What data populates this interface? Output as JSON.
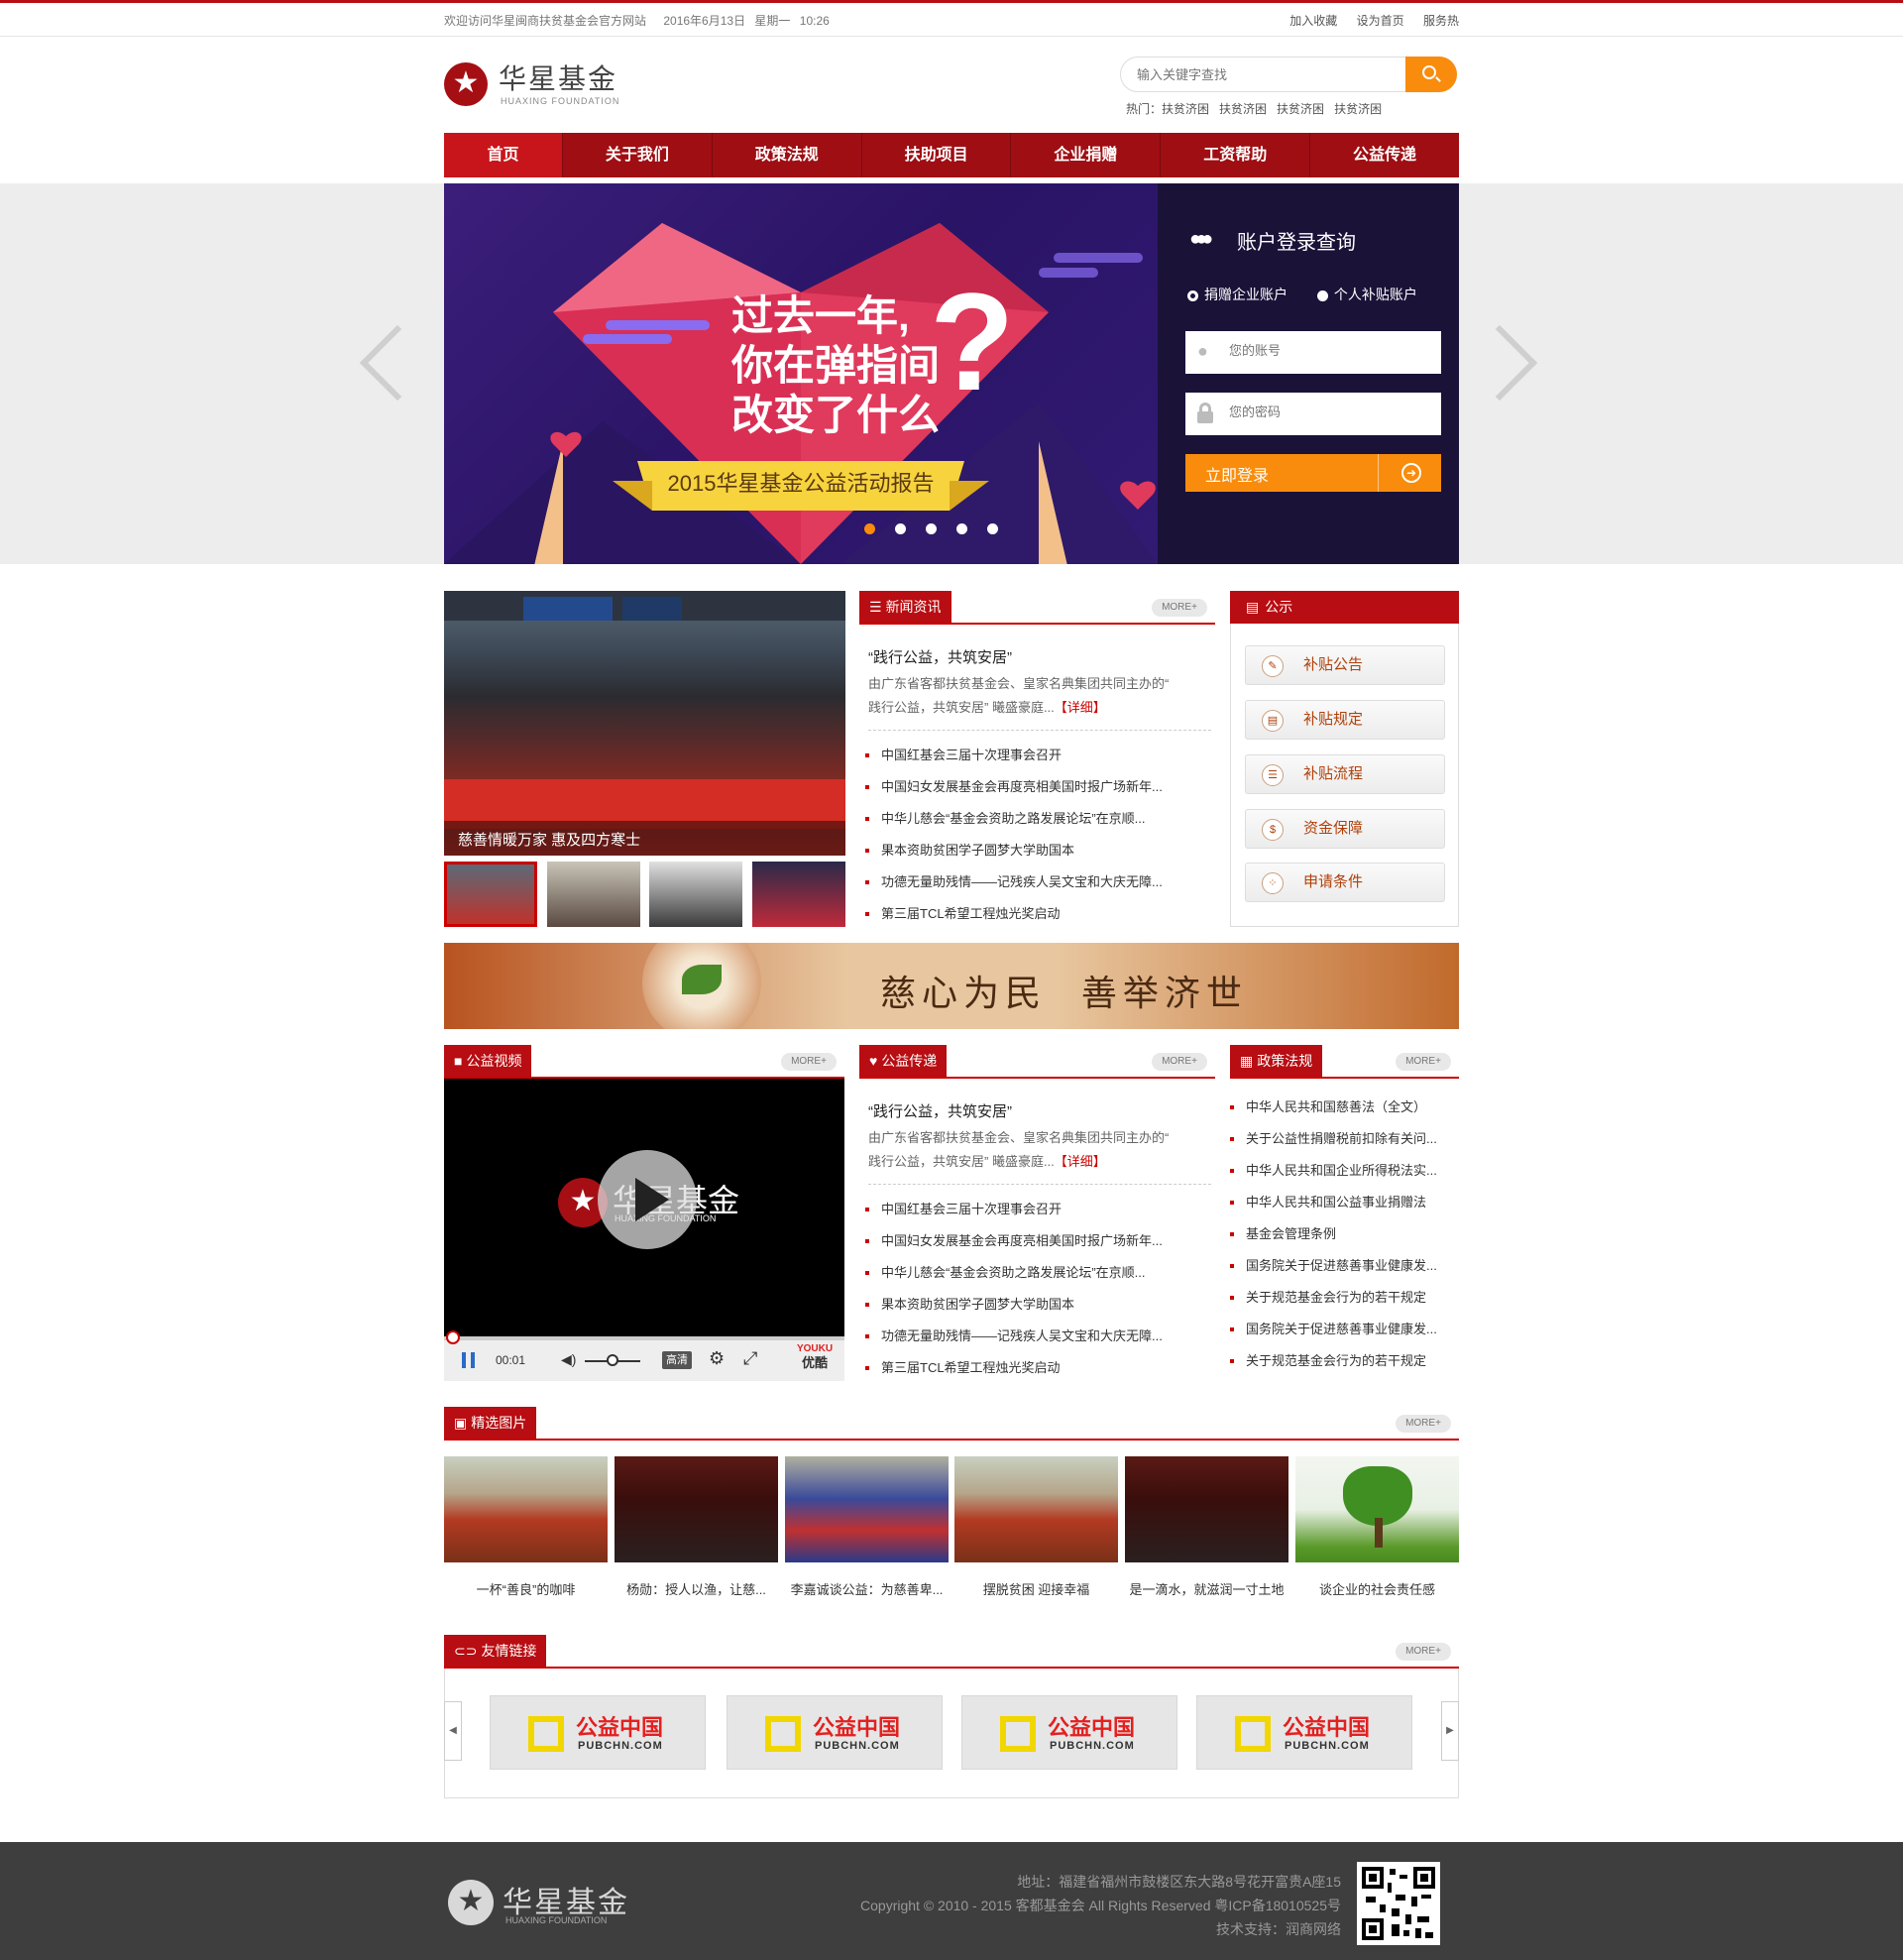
{
  "topbar": {
    "welcome": "欢迎访问华星闽商扶贫基金会官方网站",
    "date": "2016年6月13日",
    "weekday": "星期一",
    "time": "10:26",
    "links": [
      "加入收藏",
      "设为首页",
      "服务热"
    ]
  },
  "logo": {
    "cn": "华星基金",
    "en": "HUAXING   FOUNDATION"
  },
  "search": {
    "placeholder": "输入关键字查找",
    "hot_label": "热门：",
    "hot": [
      "扶贫济困",
      "扶贫济困",
      "扶贫济困",
      "扶贫济困"
    ]
  },
  "nav": [
    "首页",
    "关于我们",
    "政策法规",
    "扶助项目",
    "企业捐赠",
    "工资帮助",
    "公益传递"
  ],
  "banner": {
    "line1": "过去一年,",
    "line2": "你在弹指间",
    "line3": "改变了什么",
    "qmark": "?",
    "ribbon": "2015华星基金公益活动报告",
    "dots": 5,
    "active_dot": 0
  },
  "login": {
    "title": "账户登录查询",
    "options": [
      "捐赠企业账户",
      "个人补贴账户"
    ],
    "selected": 0,
    "account_placeholder": "您的账号",
    "password_placeholder": "您的密码",
    "submit": "立即登录"
  },
  "photo_news": {
    "caption": "慈善情暖万家 惠及四方寒士",
    "thumbs_count": 4,
    "active_thumb": 0
  },
  "news": {
    "tab": "新闻资讯",
    "more": "MORE+",
    "headline": "“践行公益，共筑安居”",
    "desc1": "由广东省客都扶贫基金会、皇家名典集团共同主办的“",
    "desc2": "践行公益，共筑安居” 曦盛豪庭...",
    "detail": "【详细】",
    "items": [
      "中国红基会三届十次理事会召开",
      "中国妇女发展基金会再度亮相美国时报广场新年...",
      "中华儿慈会“基金会资助之路发展论坛”在京顺...",
      "果本资助贫困学子圆梦大学助国本",
      "功德无量助残情——记残疾人吴文宝和大庆无障...",
      "第三届TCL希望工程烛光奖启动"
    ]
  },
  "notice": {
    "tab": "公示",
    "buttons": [
      {
        "icon": "pencil-icon",
        "label": "补贴公告"
      },
      {
        "icon": "document-icon",
        "label": "补贴规定"
      },
      {
        "icon": "list-icon",
        "label": "补贴流程"
      },
      {
        "icon": "dollar-icon",
        "label": "资金保障"
      },
      {
        "icon": "grid-icon",
        "label": "申请条件"
      }
    ]
  },
  "slogan": "慈心为民  善举济世",
  "video": {
    "tab": "公益视频",
    "more": "MORE+",
    "logo_cn": "华星基金",
    "logo_en": "HUAXING   FOUNDATION",
    "time": "00:01",
    "quality": "高清",
    "brand_top": "YOUKU",
    "brand_bottom": "优酷",
    "progress": 0,
    "volume": 0.5
  },
  "charity": {
    "tab": "公益传递",
    "more": "MORE+",
    "headline": "“践行公益，共筑安居”",
    "desc1": "由广东省客都扶贫基金会、皇家名典集团共同主办的“",
    "desc2": "践行公益，共筑安居” 曦盛豪庭...",
    "detail": "【详细】",
    "items": [
      "中国红基会三届十次理事会召开",
      "中国妇女发展基金会再度亮相美国时报广场新年...",
      "中华儿慈会“基金会资助之路发展论坛”在京顺...",
      "果本资助贫困学子圆梦大学助国本",
      "功德无量助残情——记残疾人吴文宝和大庆无障...",
      "第三届TCL希望工程烛光奖启动"
    ]
  },
  "policy": {
    "tab": "政策法规",
    "more": "MORE+",
    "items": [
      "中华人民共和国慈善法（全文）",
      "关于公益性捐赠税前扣除有关问...",
      " 中华人民共和国企业所得税法实...",
      "中华人民共和国公益事业捐赠法",
      " 基金会管理条例",
      "国务院关于促进慈善事业健康发...",
      "关于规范基金会行为的若干规定",
      "国务院关于促进慈善事业健康发...",
      "关于规范基金会行为的若干规定"
    ]
  },
  "pictures": {
    "tab": "精选图片",
    "more": "MORE+",
    "items": [
      "一杯“善良”的咖啡",
      "杨勋：授人以渔，让慈...",
      "李嘉诚谈公益：为慈善卑...",
      "摆脱贫困 迎接幸福",
      "是一滴水，就滋润一寸土地",
      "谈企业的社会责任感"
    ]
  },
  "links": {
    "tab": "友情链接",
    "more": "MORE+",
    "items": [
      {
        "cn": "公益中国",
        "en": "PUBCHN.COM"
      },
      {
        "cn": "公益中国",
        "en": "PUBCHN.COM"
      },
      {
        "cn": "公益中国",
        "en": "PUBCHN.COM"
      },
      {
        "cn": "公益中国",
        "en": "PUBCHN.COM"
      }
    ]
  },
  "footer": {
    "logo_cn": "华星基金",
    "logo_en": "HUAXING   FOUNDATION",
    "address": "地址：福建省福州市鼓楼区东大路8号花开富贵A座15",
    "copyright": "Copyright © 2010 - 2015 客都基金会 All Rights Reserved 粤ICP备18010525号",
    "support": "技术支持：润商网络"
  },
  "colors": {
    "brand_red": "#b80d12",
    "accent_orange": "#f98c0c",
    "footer_bg": "#3e3e3e"
  }
}
